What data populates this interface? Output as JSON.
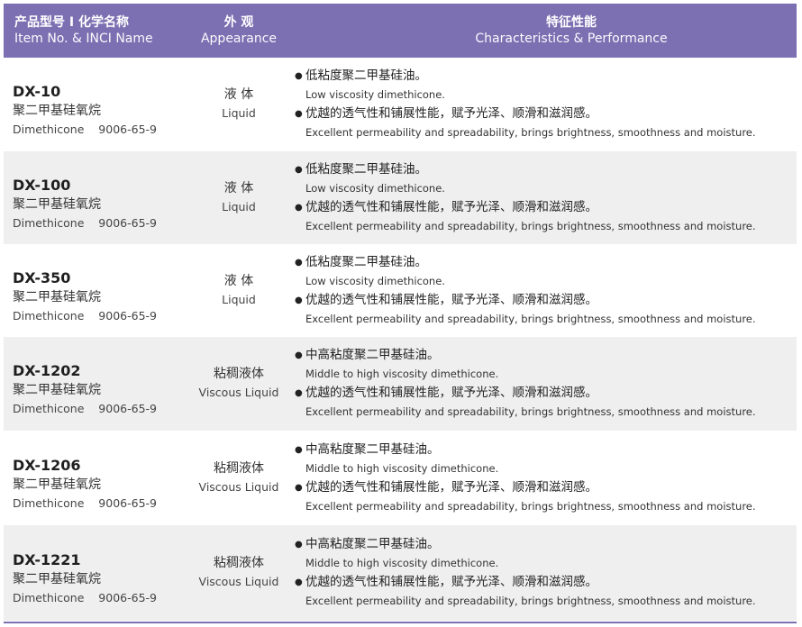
{
  "header": {
    "col1_zh": "产品型号 I 化学名称",
    "col1_en": "Item No. & INCI Name",
    "col2_zh": "外 观",
    "col2_en": "Appearance",
    "col3_zh": "特征性能",
    "col3_en": "Characteristics & Performance"
  },
  "colors": {
    "header_bg": "#7c6fb2",
    "row_alt_bg": "#efefef"
  },
  "rows": [
    {
      "code": "DX-10",
      "name_zh": "聚二甲基硅氧烷",
      "name_en": "Dimethicone    9006-65-9",
      "appearance_zh": "液 体",
      "appearance_en": "Liquid",
      "feature1_zh": "低粘度聚二甲基硅油。",
      "feature1_en": "Low viscosity dimethicone.",
      "feature2_zh": "优越的透气性和铺展性能，赋予光泽、顺滑和滋润感。",
      "feature2_en": "Excellent permeability and spreadability, brings brightness, smoothness and moisture."
    },
    {
      "code": "DX-100",
      "name_zh": "聚二甲基硅氧烷",
      "name_en": "Dimethicone    9006-65-9",
      "appearance_zh": "液 体",
      "appearance_en": "Liquid",
      "feature1_zh": "低粘度聚二甲基硅油。",
      "feature1_en": "Low viscosity dimethicone.",
      "feature2_zh": "优越的透气性和铺展性能，赋予光泽、顺滑和滋润感。",
      "feature2_en": "Excellent permeability and spreadability, brings brightness, smoothness and moisture."
    },
    {
      "code": "DX-350",
      "name_zh": "聚二甲基硅氧烷",
      "name_en": "Dimethicone    9006-65-9",
      "appearance_zh": "液 体",
      "appearance_en": "Liquid",
      "feature1_zh": "低粘度聚二甲基硅油。",
      "feature1_en": "Low viscosity dimethicone.",
      "feature2_zh": "优越的透气性和铺展性能，赋予光泽、顺滑和滋润感。",
      "feature2_en": "Excellent permeability and spreadability, brings brightness, smoothness and moisture."
    },
    {
      "code": "DX-1202",
      "name_zh": "聚二甲基硅氧烷",
      "name_en": "Dimethicone    9006-65-9",
      "appearance_zh": "粘稠液体",
      "appearance_en": "Viscous Liquid",
      "feature1_zh": "中高粘度聚二甲基硅油。",
      "feature1_en": "Middle to high viscosity dimethicone.",
      "feature2_zh": "优越的透气性和铺展性能，赋予光泽、顺滑和滋润感。",
      "feature2_en": "Excellent permeability and spreadability, brings brightness, smoothness and moisture."
    },
    {
      "code": "DX-1206",
      "name_zh": "聚二甲基硅氧烷",
      "name_en": "Dimethicone    9006-65-9",
      "appearance_zh": "粘稠液体",
      "appearance_en": "Viscous Liquid",
      "feature1_zh": "中高粘度聚二甲基硅油。",
      "feature1_en": "Middle to high viscosity dimethicone.",
      "feature2_zh": "优越的透气性和铺展性能，赋予光泽、顺滑和滋润感。",
      "feature2_en": "Excellent permeability and spreadability, brings brightness, smoothness and moisture."
    },
    {
      "code": "DX-1221",
      "name_zh": "聚二甲基硅氧烷",
      "name_en": "Dimethicone    9006-65-9",
      "appearance_zh": "粘稠液体",
      "appearance_en": "Viscous Liquid",
      "feature1_zh": "中高粘度聚二甲基硅油。",
      "feature1_en": "Middle to high viscosity dimethicone.",
      "feature2_zh": "优越的透气性和铺展性能，赋予光泽、顺滑和滋润感。",
      "feature2_en": "Excellent permeability and spreadability, brings brightness, smoothness and moisture."
    }
  ]
}
